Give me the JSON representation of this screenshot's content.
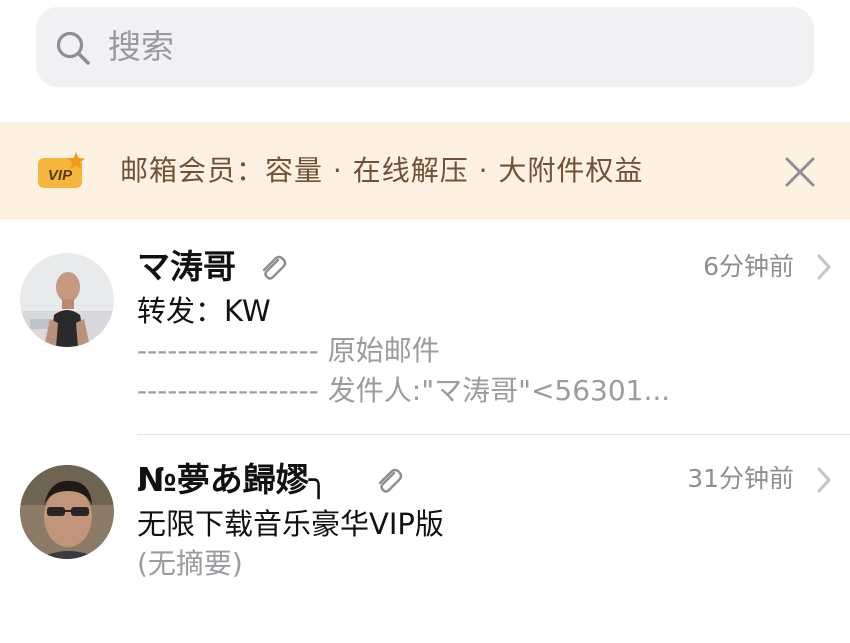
{
  "search": {
    "placeholder": "搜索"
  },
  "vip_banner": {
    "badge_text": "VIP",
    "text": "邮箱会员：容量 · 在线解压 · 大附件权益"
  },
  "mails": [
    {
      "sender": "マ涛哥",
      "has_attachment": true,
      "time": "6分钟前",
      "subject": "转发：KW",
      "preview_lines": [
        "------------------ 原始邮件",
        "------------------ 发件人:\"マ涛哥\"<56301..."
      ]
    },
    {
      "sender": "№夢あ歸嫪╮",
      "has_attachment": true,
      "time": "31分钟前",
      "subject": "无限下载音乐豪华VIP版",
      "preview_lines": [
        "(无摘要)"
      ]
    }
  ],
  "colors": {
    "search_bg": "#f1f1f3",
    "banner_bg": "#fdf1e1",
    "banner_text": "#71513a",
    "vip_badge": "#f6b53d",
    "secondary_text": "#8e8e93"
  }
}
